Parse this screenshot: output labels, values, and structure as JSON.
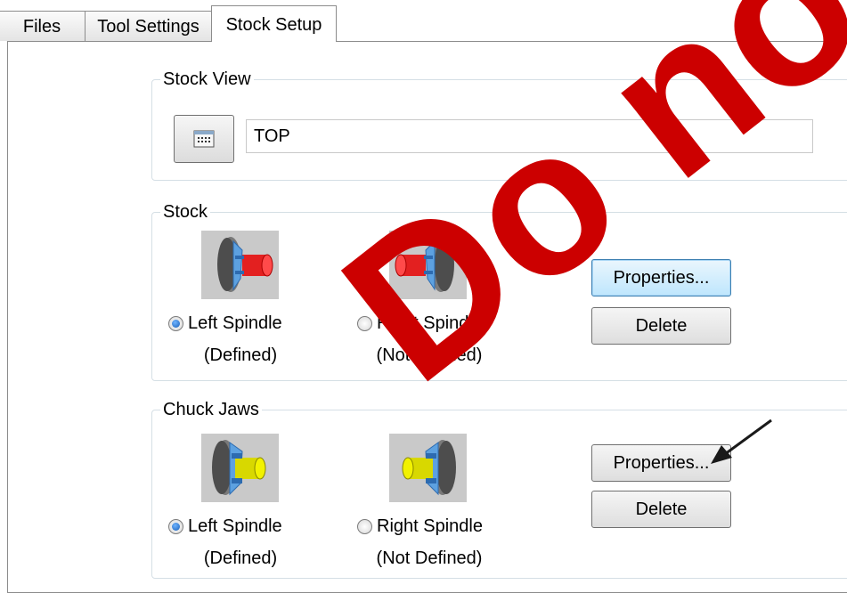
{
  "tabs": [
    {
      "label": "Files",
      "active": false
    },
    {
      "label": "Tool Settings",
      "active": false
    },
    {
      "label": "Stock Setup",
      "active": true
    }
  ],
  "stock_view": {
    "title": "Stock View",
    "button_icon": "view-selector-icon",
    "value": "TOP"
  },
  "stock": {
    "title": "Stock",
    "left": {
      "label": "Left Spindle",
      "state": "(Defined)",
      "checked": true,
      "part_color": "#e32020",
      "icon": "left-spindle-stock-icon"
    },
    "right": {
      "label": "Right Spindle",
      "state": "(Not Defined)",
      "checked": false,
      "part_color": "#e32020",
      "icon": "right-spindle-stock-icon"
    },
    "properties_label": "Properties...",
    "delete_label": "Delete"
  },
  "chuck_jaws": {
    "title": "Chuck Jaws",
    "left": {
      "label": "Left Spindle",
      "state": "(Defined)",
      "checked": true,
      "part_color": "#e6e600",
      "icon": "left-spindle-chuck-icon"
    },
    "right": {
      "label": "Right Spindle",
      "state": "(Not Defined)",
      "checked": false,
      "part_color": "#e6e600",
      "icon": "right-spindle-chuck-icon"
    },
    "properties_label": "Properties...",
    "delete_label": "Delete"
  },
  "watermark": {
    "text": "Do not Distribute",
    "color": "#cc0000"
  },
  "annotation": {
    "icon": "arrow-pointer-icon",
    "color": "#1a1a1a"
  }
}
